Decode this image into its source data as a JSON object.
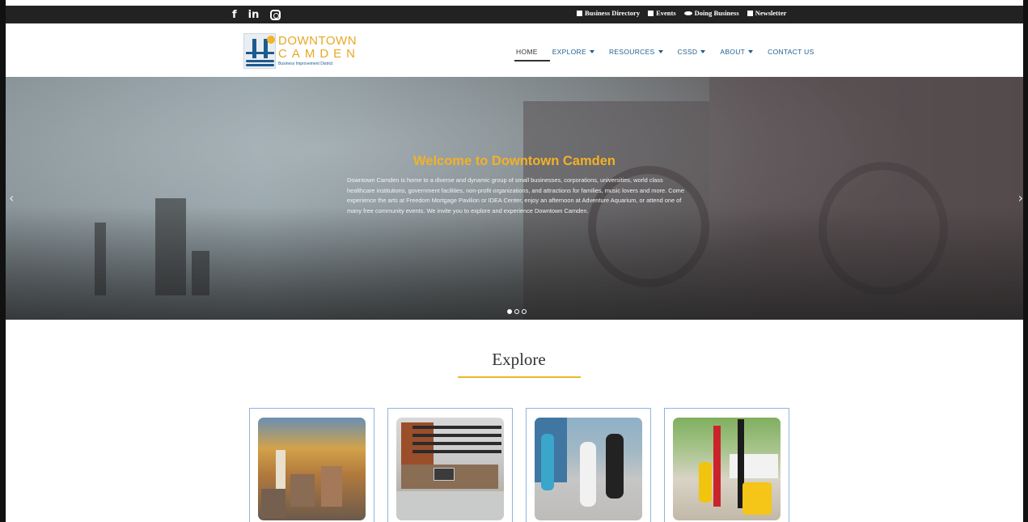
{
  "topbar": {
    "social": [
      "f",
      "in",
      "instagram"
    ],
    "links": [
      {
        "label": "Business Directory",
        "icon": "building-icon"
      },
      {
        "label": "Events",
        "icon": "calendar-icon"
      },
      {
        "label": "Doing Business",
        "icon": "handshake-icon"
      },
      {
        "label": "Newsletter",
        "icon": "newsletter-icon"
      }
    ]
  },
  "logo": {
    "line1": "DOWNTOWN",
    "line2": "CAMDEN",
    "line3": "Business Improvement District"
  },
  "nav": {
    "items": [
      {
        "label": "HOME",
        "has_menu": false
      },
      {
        "label": "EXPLORE",
        "has_menu": true
      },
      {
        "label": "RESOURCES",
        "has_menu": true
      },
      {
        "label": "CSSD",
        "has_menu": true
      },
      {
        "label": "ABOUT",
        "has_menu": true
      },
      {
        "label": "CONTACT US",
        "has_menu": false
      }
    ],
    "active": "HOME"
  },
  "hero": {
    "title": "Welcome to Downtown Camden",
    "body": "Downtown Camden is home to a diverse and dynamic group of small businesses, corporations, universities, world class healthcare institutions, government facilities, non-profit organizations, and attractions for families, music lovers and more. Come experience the arts at Freedom Mortgage Pavilion or IDEA Center, enjoy an afternoon at Adventure Aquarium, or attend one of many free community events. We invite you to explore and experience Downtown Camden.",
    "prev_glyph": "‹",
    "next_glyph": "›",
    "slides": 3,
    "active_slide": 1
  },
  "explore": {
    "title": "Explore"
  },
  "colors": {
    "accent": "#f0b528",
    "nav_blue": "#1f5f92",
    "topbar": "#222222"
  }
}
